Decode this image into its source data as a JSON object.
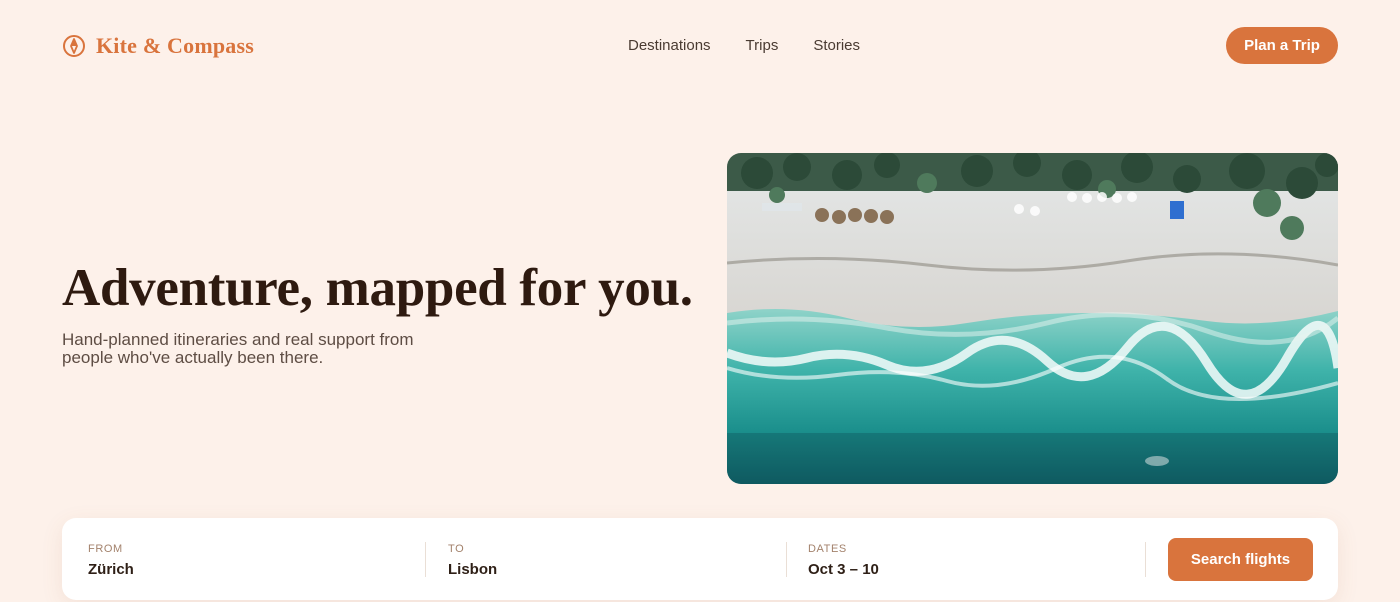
{
  "brand": {
    "name": "Kite & Compass",
    "icon": "compass-icon"
  },
  "nav": {
    "items": [
      "Destinations",
      "Trips",
      "Stories"
    ]
  },
  "header": {
    "cta_label": "Plan a Trip"
  },
  "hero": {
    "title": "Adventure, mapped for you.",
    "subtitle": "Hand-planned itineraries and real support from people who've actually been there.",
    "image_alt": "Aerial view of a turquoise beach with palm trees and umbrellas"
  },
  "search": {
    "from": {
      "label": "FROM",
      "value": "Zürich"
    },
    "to": {
      "label": "TO",
      "value": "Lisbon"
    },
    "dates": {
      "label": "DATES",
      "value": "Oct 3 – 10"
    },
    "button_label": "Search flights"
  },
  "colors": {
    "background": "#fdf1ea",
    "accent": "#d9743d",
    "heading": "#2e1a10",
    "card": "#ffffff"
  }
}
